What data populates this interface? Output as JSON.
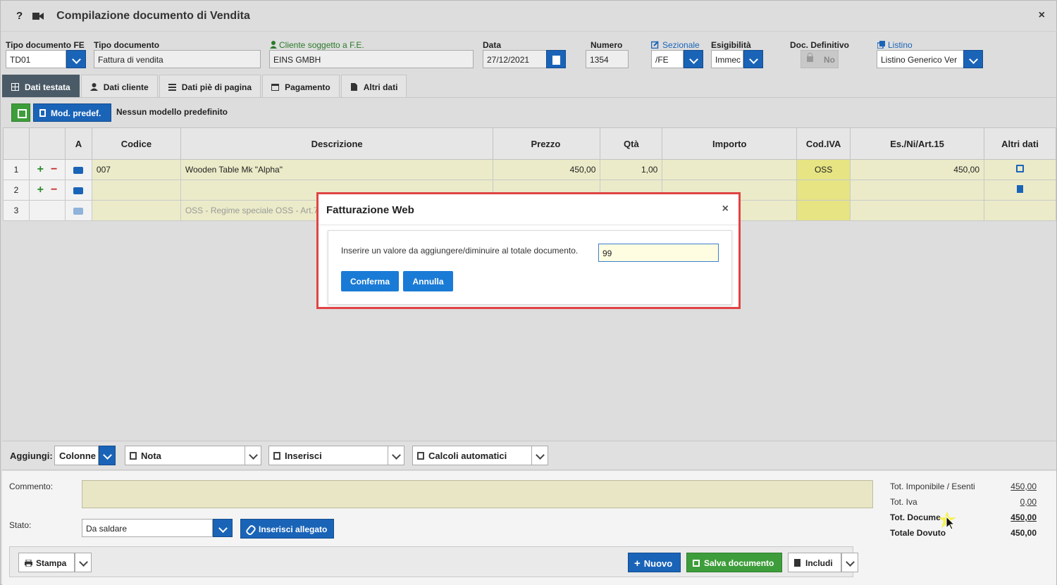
{
  "window": {
    "title": "Compilazione documento di Vendita",
    "help": "?",
    "close": "×"
  },
  "header": {
    "tipo_fe_label": "Tipo documento FE",
    "tipo_fe_value": "TD01",
    "tipo_doc_label": "Tipo documento",
    "tipo_doc_value": "Fattura di vendita",
    "cliente_label": "Cliente soggetto a F.E.",
    "cliente_value": "EINS GMBH",
    "data_label": "Data",
    "data_value": "27/12/2021",
    "numero_label": "Numero",
    "numero_value": "1354",
    "sezionale_label": "Sezionale",
    "sezionale_value": "/FE",
    "esigibilita_label": "Esigibilità",
    "esigibilita_value": "Immec",
    "definitivo_label": "Doc. Definitivo",
    "definitivo_value": "No",
    "listino_label": "Listino",
    "listino_value": "Listino Generico Ver"
  },
  "tabs": [
    "Dati testata",
    "Dati cliente",
    "Dati piè di pagina",
    "Pagamento",
    "Altri dati"
  ],
  "toolbar": {
    "mod_predef": "Mod. predef.",
    "model_text": "Nessun modello predefinito"
  },
  "grid": {
    "columns": [
      "A",
      "Codice",
      "Descrizione",
      "Prezzo",
      "Qtà",
      "Importo",
      "Cod.IVA",
      "Es./Ni/Art.15",
      "Altri dati"
    ],
    "rows": [
      {
        "n": "1",
        "codice": "007",
        "descrizione": "Wooden Table Mk \"Alpha\"",
        "prezzo": "450,00",
        "qta": "1,00",
        "importo": "",
        "iva": "OSS",
        "es": "450,00"
      },
      {
        "n": "2",
        "codice": "",
        "descrizione": "",
        "prezzo": "",
        "qta": "",
        "importo": "",
        "iva": "",
        "es": ""
      },
      {
        "n": "3",
        "codice": "",
        "descrizione": "OSS - Regime speciale OSS - Art.74",
        "prezzo": "",
        "qta": "",
        "importo": "",
        "iva": "",
        "es": ""
      }
    ]
  },
  "aggiungi": {
    "label": "Aggiungi:",
    "colonne": "Colonne",
    "nota": "Nota",
    "inserisci": "Inserisci",
    "calcoli": "Calcoli automatici"
  },
  "footer": {
    "commento_label": "Commento:",
    "stato_label": "Stato:",
    "stato_value": "Da saldare",
    "allegato": "Inserisci allegato",
    "stampa": "Stampa",
    "nuovo": "Nuovo",
    "salva": "Salva documento",
    "includi": "Includi"
  },
  "totals": [
    {
      "label": "Tot. Imponibile / Esenti",
      "value": "450,00"
    },
    {
      "label": "Tot. Iva",
      "value": "0,00"
    },
    {
      "label": "Tot. Docume",
      "value": "450,00"
    },
    {
      "label": "Totale Dovuto",
      "value": "450,00"
    }
  ],
  "modal": {
    "title": "Fatturazione Web",
    "close": "×",
    "text": "Inserire un valore da aggiungere/diminuire al totale documento.",
    "input_value": "99",
    "confirm": "Conferma",
    "cancel": "Annulla"
  },
  "colors": {
    "primary": "#1a64b8",
    "success": "#3e9d3b",
    "danger_border": "#e04444",
    "tab_active": "#4a5a66"
  }
}
